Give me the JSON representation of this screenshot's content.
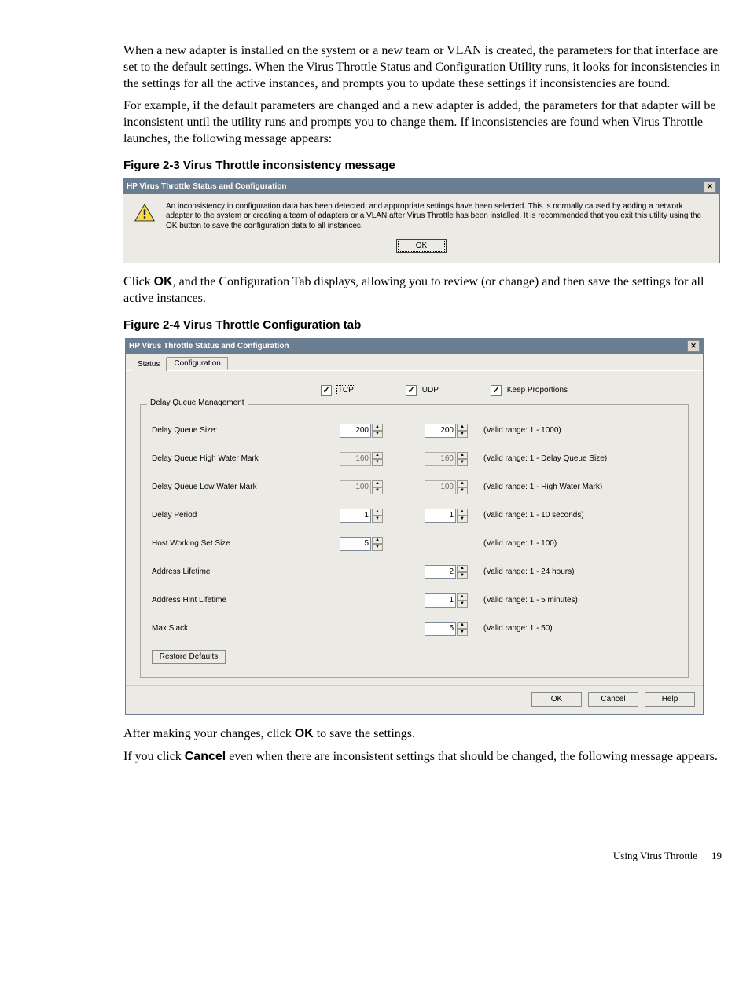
{
  "paragraphs": {
    "p1": "When a new adapter is installed on the system or a new team or VLAN is created, the parameters for that interface are set to the default settings. When the Virus Throttle Status and Configuration Utility runs, it looks for inconsistencies in the settings for all the active instances, and prompts you to update these settings if inconsistencies are found.",
    "p2": "For example, if the default parameters are changed and a new adapter is added, the parameters for that adapter will be inconsistent until the utility runs and prompts you to change them. If inconsistencies are found when Virus Throttle launches, the following message appears:",
    "p3a": "Click ",
    "p3b": "OK",
    "p3c": ", and the Configuration Tab displays, allowing you to review (or change) and then save the settings for all active instances.",
    "p4a": "After making your changes, click ",
    "p4b": "OK",
    "p4c": " to save the settings.",
    "p5a": "If you click ",
    "p5b": "Cancel",
    "p5c": " even when there are inconsistent settings that should be changed, the following message appears."
  },
  "captions": {
    "fig23": "Figure 2-3 Virus Throttle inconsistency message",
    "fig24": "Figure 2-4 Virus Throttle Configuration tab"
  },
  "dialog1": {
    "title": "HP Virus Throttle Status and Configuration",
    "message": "An inconsistency in configuration data has been detected, and appropriate settings have been selected.  This is normally caused by adding a network adapter to the system or creating a team of adapters or a VLAN after Virus Throttle has been installed.  It is recommended that you exit this utility using the OK button to save the configuration data to all instances.",
    "ok": "OK"
  },
  "dialog2": {
    "title": "HP Virus Throttle Status and Configuration",
    "tabs": {
      "status": "Status",
      "config": "Configuration"
    },
    "headers": {
      "tcp": "TCP",
      "udp": "UDP",
      "keep": "Keep Proportions"
    },
    "checked": {
      "tcp": true,
      "udp": true,
      "keep": true
    },
    "group": "Delay Queue Management",
    "rows": {
      "dqs": {
        "label": "Delay Queue Size:",
        "tcp": "200",
        "udp": "200",
        "hint": "(Valid range: 1 - 1000)"
      },
      "dqhw": {
        "label": "Delay Queue High Water Mark",
        "tcp": "160",
        "udp": "160",
        "hint": "(Valid range: 1 - Delay Queue Size)",
        "disabled": true
      },
      "dqlw": {
        "label": "Delay Queue Low Water Mark",
        "tcp": "100",
        "udp": "100",
        "hint": "(Valid range: 1 - High Water Mark)",
        "disabled": true
      },
      "dp": {
        "label": "Delay Period",
        "tcp": "1",
        "udp": "1",
        "hint": "(Valid range: 1 - 10 seconds)"
      },
      "hwss": {
        "label": "Host Working Set Size",
        "tcp": "5",
        "hint": "(Valid range: 1 - 100)"
      },
      "al": {
        "label": "Address Lifetime",
        "udp": "2",
        "hint": "(Valid range: 1 - 24 hours)"
      },
      "ahl": {
        "label": "Address Hint Lifetime",
        "udp": "1",
        "hint": "(Valid range: 1 - 5 minutes)"
      },
      "ms": {
        "label": "Max Slack",
        "udp": "5",
        "hint": "(Valid range: 1 - 50)"
      }
    },
    "restore": "Restore Defaults",
    "buttons": {
      "ok": "OK",
      "cancel": "Cancel",
      "help": "Help"
    }
  },
  "footer": {
    "section": "Using Virus Throttle",
    "page": "19"
  }
}
